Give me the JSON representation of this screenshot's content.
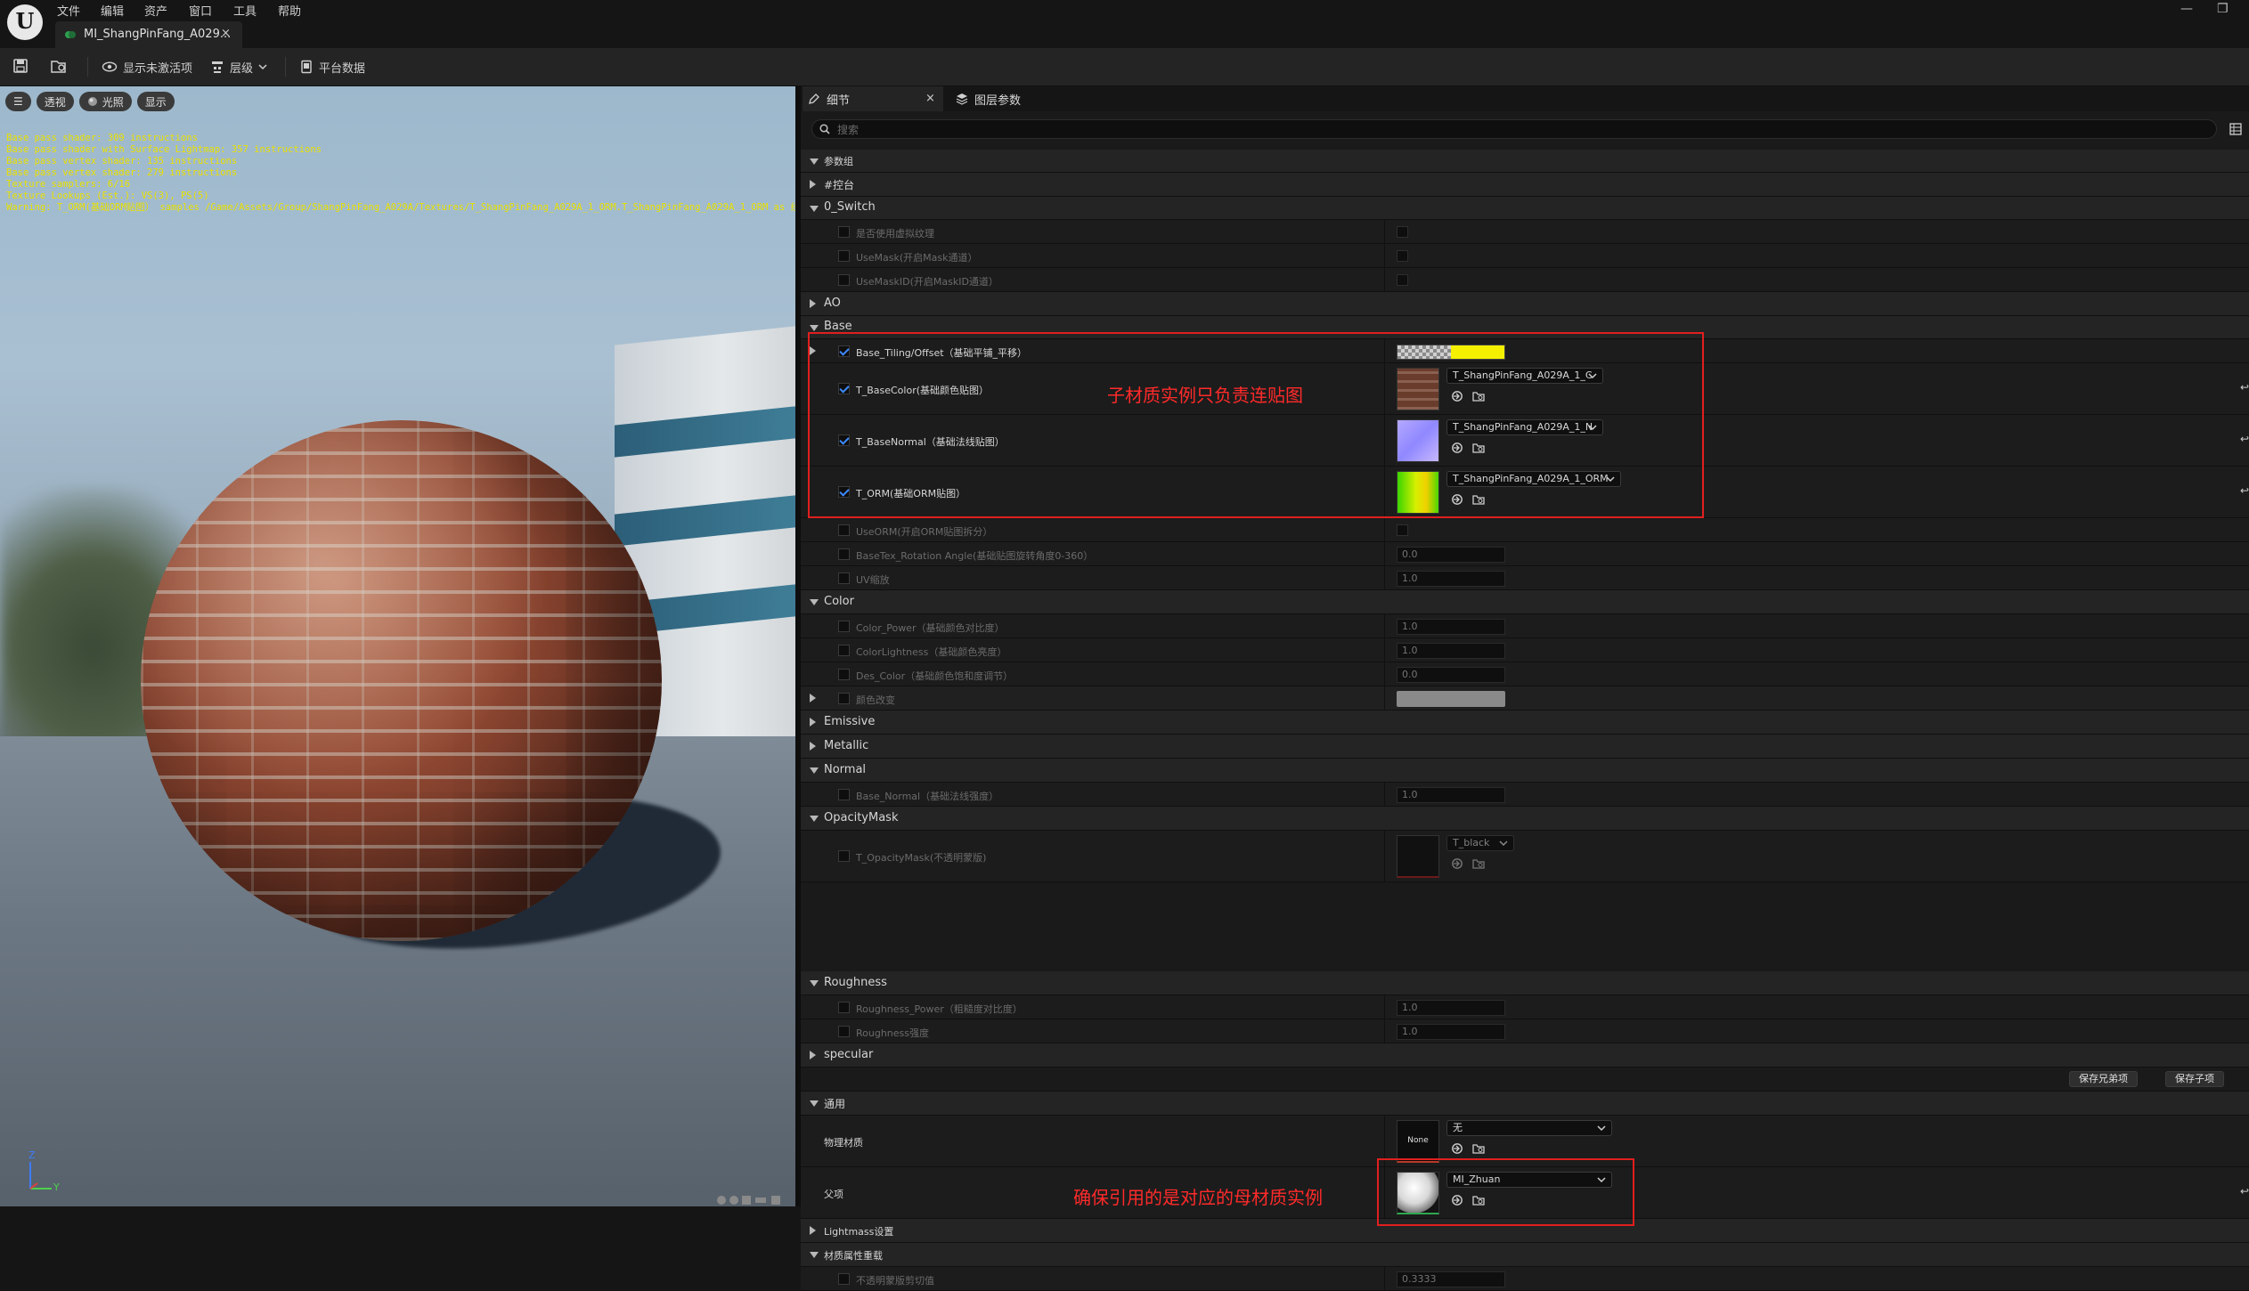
{
  "app": {
    "menu": [
      "文件",
      "编辑",
      "资产",
      "窗口",
      "工具",
      "帮助"
    ],
    "doc_tab": "MI_ShangPinFang_A029...",
    "close_glyph": "×",
    "window_controls": [
      "—",
      "❐"
    ]
  },
  "toolbar": {
    "show_inactive": "显示未激活项",
    "hierarchy": "层级",
    "platform_stats": "平台数据"
  },
  "viewport": {
    "buttons": {
      "menu": "☰",
      "perspective": "透视",
      "lighting": "光照",
      "show": "显示"
    },
    "stats": [
      "Base pass shader: 309 instructions",
      "Base pass shader with Surface Lightmap: 357 instructions",
      "Base pass vertex shader: 135 instructions",
      "Base pass vertex shader: 279 instructions",
      "Texture samplers: 6/16",
      "Texture Lookups (Est.): VS(3), PS(5)",
      "Warning: T_ORM(基础ORM贴图） samples /Game/Assets/Group/ShangPinFang_A029A/Textures/T_ShangPinFang_A029A_1_ORM.T_ShangPinFang_A029A_1_ORM as 线性颜色."
    ],
    "axis_labels": {
      "z": "Z",
      "y": "Y"
    }
  },
  "panel": {
    "tab_details": "细节",
    "tab_layer_params": "图层参数",
    "search_placeholder": "搜索",
    "categories": {
      "params_group": "参数组",
      "console": "#控台",
      "switch": "0_Switch",
      "ao": "AO",
      "base": "Base",
      "color": "Color",
      "emissive": "Emissive",
      "metallic": "Metallic",
      "normal": "Normal",
      "opacity_mask": "OpacityMask",
      "roughness": "Roughness",
      "specular": "specular",
      "general": "通用",
      "lightmass": "Lightmass设置",
      "material_overrides": "材质属性重载"
    },
    "switch": {
      "use_virtual_texture": "是否使用虚拟纹理",
      "use_mask": "UseMask(开启Mask通道）",
      "use_mask_id": "UseMaskID(开启MaskID通道）"
    },
    "base": {
      "tiling_offset": "Base_Tiling/Offset（基础平铺_平移）",
      "base_color": "T_BaseColor(基础颜色贴图）",
      "base_color_asset": "T_ShangPinFang_A029A_1_C",
      "base_normal": "T_BaseNormal（基础法线贴图）",
      "base_normal_asset": "T_ShangPinFang_A029A_1_N",
      "orm": "T_ORM(基础ORM贴图）",
      "orm_asset": "T_ShangPinFang_A029A_1_ORM",
      "use_orm": "UseORM(开启ORM贴图拆分）",
      "rotation_angle": "BaseTex_Rotation Angle(基础贴图旋转角度0-360）",
      "rotation_value": "0.0",
      "uv_scale": "UV缩放",
      "uv_value": "1.0"
    },
    "color": {
      "power": "Color_Power（基础颜色对比度）",
      "power_value": "1.0",
      "lightness": "ColorLightness（基础颜色亮度）",
      "lightness_value": "1.0",
      "des": "Des_Color（基础颜色饱和度调节）",
      "des_value": "0.0",
      "tint": "颜色改变"
    },
    "normal": {
      "base_normal": "Base_Normal（基础法线强度）",
      "value": "1.0"
    },
    "opacity": {
      "mask": "T_OpacityMask(不透明蒙版)",
      "asset": "T_black"
    },
    "roughness": {
      "power": "Roughness_Power（粗糙度对比度）",
      "power_value": "1.0",
      "intensity": "Roughness强度",
      "intensity_value": "1.0"
    },
    "buttons": {
      "save_sibling": "保存兄弟项",
      "save_child": "保存子项"
    },
    "general": {
      "phys_material": "物理材质",
      "phys_thumb": "None",
      "phys_value": "无",
      "parent": "父项",
      "parent_value": "MI_Zhuan"
    },
    "overrides": {
      "opacity_clip": "不透明蒙版剪切值",
      "opacity_clip_value": "0.3333"
    },
    "edge_arrows": [
      "↩",
      "↩",
      "↩",
      "↩"
    ]
  },
  "annotations": {
    "child_textures": "子材质实例只负责连贴图",
    "parent_ref": "确保引用的是对应的母材质实例"
  },
  "colors": {
    "annotation_red": "#e01f1f",
    "checkbox_accent": "#3d8bff",
    "tiling_yellow": "#f5f000",
    "stats_yellow": "#e8e000"
  }
}
